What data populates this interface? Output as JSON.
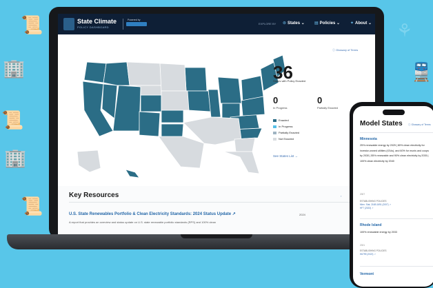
{
  "header": {
    "title_line1": "State Climate",
    "title_line2": "POLICY DASHBOARD",
    "powered_by": "Powered by",
    "nav_explore": "EXPLORE BY",
    "nav_items": [
      {
        "label": "States",
        "icon": "pin-icon"
      },
      {
        "label": "Policies",
        "icon": "document-icon"
      },
      {
        "label": "About",
        "icon": "star-icon"
      }
    ]
  },
  "map_section": {
    "glossary_link": "Glossary of Terms",
    "enacted_count": "36",
    "enacted_caption": "States with Policy Enacted",
    "in_progress_count": "0",
    "in_progress_caption": "In Progress",
    "partially_count": "0",
    "partially_caption": "Partially Enacted",
    "legend": [
      {
        "label": "Enacted",
        "color": "#2b6d86"
      },
      {
        "label": "In Progress",
        "color": "#57c0e8"
      },
      {
        "label": "Partially Enacted",
        "color": "#9fb4c2"
      },
      {
        "label": "Not Enacted",
        "color": "#d7dbdf"
      }
    ],
    "see_list": "See States List"
  },
  "key_resources": {
    "heading": "Key Resources",
    "resource_title": "U.S. State Renewables Portfolio & Clean Electricity Standards: 2024 Status Update",
    "resource_desc": "A report that provides an overview and status update on U.S. state renewable portfolio standards (RPS) and 100% clean",
    "resource_year": "2024"
  },
  "phone": {
    "title": "Model States",
    "glossary_link": "Glossary of Terms",
    "states": [
      {
        "name": "Minnesota",
        "desc": "25% renewable energy by 2025 | 80% clean electricity for investor-owned utilities (IOUs), and 60% for munis and coops by 2030 | 55% renewable and 90% clean electricity by 2035 | 100% clean electricity by 2040",
        "year": "2007",
        "policy_label": "ESTABLISHING POLICIES",
        "policy_links": "Minn. Stat. 216B.1691 (2007)",
        "policy_link2": "HF7 (2023)"
      },
      {
        "name": "Rhode Island",
        "desc": "100% renewable energy by 2033",
        "year": "2021",
        "policy_label": "ESTABLISHING POLICIES",
        "policy_links": "H6799 (2022)"
      },
      {
        "name": "Vermont"
      }
    ]
  },
  "colors": {
    "enacted": "#2b6d86",
    "not_enacted": "#d7dbdf",
    "header_bg": "#0e1f36",
    "page_bg": "#58c6e9"
  }
}
